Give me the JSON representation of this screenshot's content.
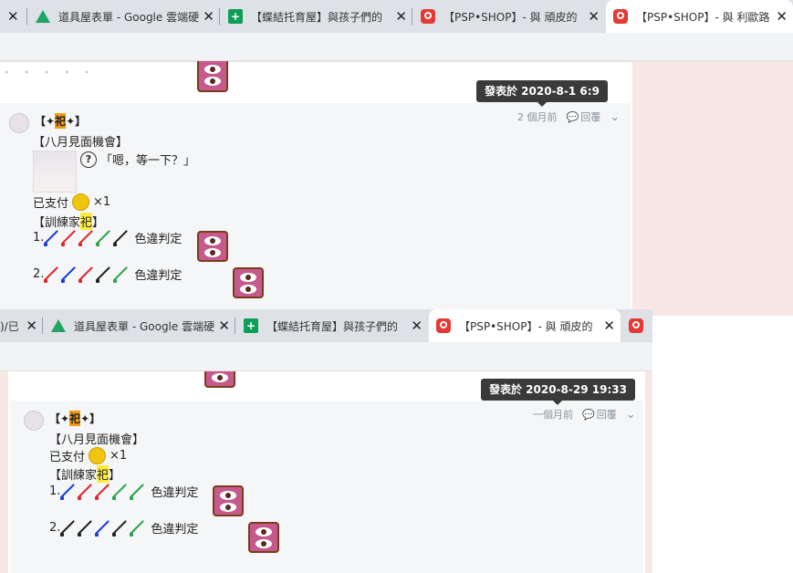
{
  "colors": {
    "accent_orange": "#f39c12",
    "accent_yellow": "#ffeb3b",
    "tip_bg": "#3a3a3a",
    "blue": "#1a3dd6",
    "red": "#e0262b",
    "green": "#2aa34a",
    "black": "#222222"
  },
  "top": {
    "tabs": [
      {
        "icon": "close-icon",
        "title": "",
        "close": "✕"
      },
      {
        "icon": "google-drive-icon",
        "title": "道具屋表單 - Google 雲端硬",
        "close": "✕"
      },
      {
        "icon": "google-sheets-icon",
        "title": "【蝶結托育屋】與孩子們的",
        "close": "✕"
      },
      {
        "icon": "psp-shop-icon",
        "title": "【PSP•SHOP】- 與 頑皮的",
        "close": "✕"
      },
      {
        "icon": "psp-shop-icon",
        "title": "【PSP•SHOP】- 與 利歐路",
        "close": "✕"
      }
    ],
    "dots": "• • • • •",
    "tooltip": "發表於 2020-8-1 6:9",
    "time_ago": "2 個月前",
    "reply": "回覆",
    "author": {
      "pre": "【✦",
      "mark": "祀",
      "post": "✦】"
    },
    "event": "【八月見面機會】",
    "dialogue": "「嗯，等一下？」",
    "paid": {
      "label": "已支付",
      "count": "×1"
    },
    "trainer": {
      "pre": "【訓練家 ",
      "mark": "祀",
      "post": "】"
    },
    "rows": [
      {
        "num": "1.",
        "spears": [
          "blue",
          "red",
          "red",
          "green",
          "black"
        ],
        "text": "色違判定"
      },
      {
        "num": "2.",
        "spears": [
          "red",
          "blue",
          "red",
          "black",
          "green"
        ],
        "text": "色違判定"
      }
    ]
  },
  "bottom": {
    "tabs": [
      {
        "icon": "doc-icon",
        "title": ")/已",
        "close": "✕"
      },
      {
        "icon": "google-drive-icon",
        "title": "道具屋表單 - Google 雲端硬",
        "close": "✕"
      },
      {
        "icon": "google-sheets-icon",
        "title": "【蝶結托育屋】與孩子們的",
        "close": "✕"
      },
      {
        "icon": "psp-shop-icon",
        "title": "【PSP•SHOP】- 與 頑皮的",
        "close": "✕"
      },
      {
        "icon": "psp-shop-icon",
        "title": "",
        "close": ""
      }
    ],
    "tooltip": "發表於 2020-8-29 19:33",
    "time_ago": "一個月前",
    "reply": "回覆",
    "author": {
      "pre": "【✦",
      "mark": "祀",
      "post": "✦】"
    },
    "event": "【八月見面機會】",
    "paid": {
      "label": "已支付",
      "count": "×1"
    },
    "trainer": {
      "pre": "【訓練家 ",
      "mark": "祀",
      "post": "】"
    },
    "rows": [
      {
        "num": "1.",
        "spears": [
          "blue",
          "red",
          "red",
          "green",
          "green"
        ],
        "text": "色違判定"
      },
      {
        "num": "2.",
        "spears": [
          "black",
          "black",
          "blue",
          "black",
          "green"
        ],
        "text": "色違判定"
      }
    ]
  }
}
